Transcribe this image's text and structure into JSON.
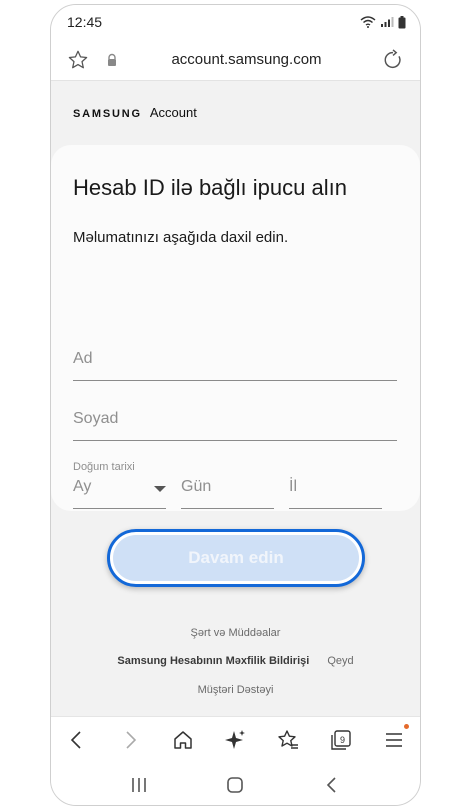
{
  "status": {
    "time": "12:45"
  },
  "browser": {
    "url": "account.samsung.com"
  },
  "brand": {
    "wordmark": "SAMSUNG",
    "product": "Account"
  },
  "form": {
    "title": "Hesab ID ilə bağlı ipucu alın",
    "subtitle": "Məlumatınızı aşağıda daxil edin.",
    "first_name_placeholder": "Ad",
    "last_name_placeholder": "Soyad",
    "dob_label": "Doğum tarixi",
    "month_placeholder": "Ay",
    "day_placeholder": "Gün",
    "year_placeholder": "İl"
  },
  "continue_button": {
    "label": "Davam edin"
  },
  "footer_links": {
    "terms": "Şərt və Müddəalar",
    "privacy": "Samsung Hesabının Məxfilik Bildirişi",
    "notice": "Qeyd",
    "support": "Müştəri Dəstəyi"
  },
  "colors": {
    "accent": "#1368d8",
    "button_fill": "#cfe0f6",
    "notification_dot": "#e46a2c"
  },
  "icons": {
    "browser_toolbar": [
      "back-icon",
      "forward-icon",
      "home-icon",
      "sparkle-icon",
      "bookmarks-icon",
      "tabs-icon",
      "menu-icon"
    ],
    "tab_count": "9",
    "system_nav": [
      "recents-icon",
      "home-circle-icon",
      "system-back-icon"
    ]
  }
}
